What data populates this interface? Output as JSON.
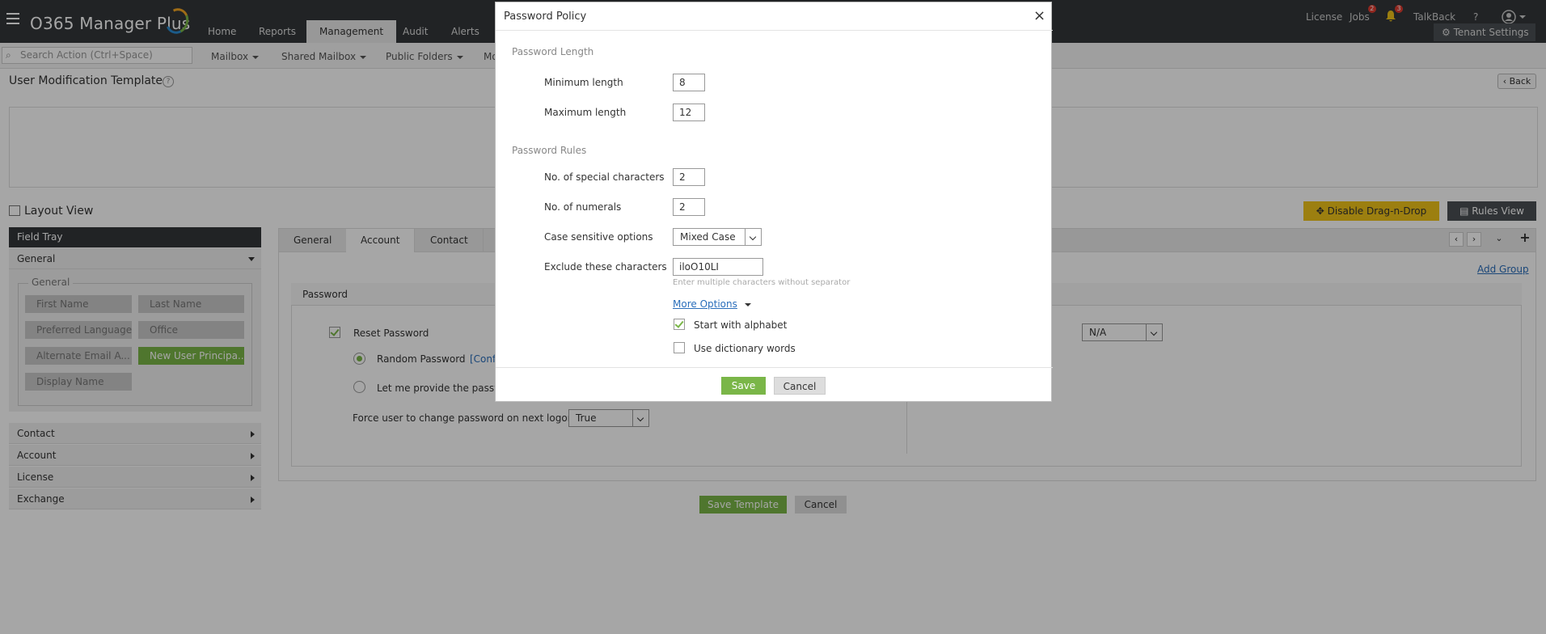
{
  "app": {
    "title": "O365 Manager Plus"
  },
  "nav": {
    "tabs": [
      "Home",
      "Reports",
      "Management",
      "Audit",
      "Alerts"
    ],
    "active": "Management"
  },
  "top_right": {
    "license": "License",
    "jobs": "Jobs",
    "jobs_badge": "2",
    "alerts_badge": "3",
    "talkback": "TalkBack",
    "help": "?",
    "tenant_settings": "Tenant Settings"
  },
  "subbar": {
    "search_placeholder": "Search Action (Ctrl+Space)",
    "items": [
      "Mailbox",
      "Shared Mailbox",
      "Public Folders",
      "Mo"
    ]
  },
  "page": {
    "title": "User Modification Template",
    "back": "Back"
  },
  "layout": {
    "label": "Layout View",
    "disable_drag": "Disable Drag-n-Drop",
    "rules_view": "Rules View"
  },
  "tray": {
    "header": "Field Tray",
    "general_section": "General",
    "legend": "General",
    "fields": [
      "First Name",
      "Last Name",
      "Preferred Language",
      "Office",
      "Alternate Email A...",
      "New User Principa...",
      "Display Name"
    ],
    "sections": [
      "Contact",
      "Account",
      "License",
      "Exchange"
    ]
  },
  "form": {
    "tabs": [
      "General",
      "Account",
      "Contact"
    ],
    "active_tab": "Account",
    "add_group": "Add Group",
    "group_title": "Password",
    "reset_password": "Reset Password",
    "random_password": "Random Password",
    "configure_link": "[Conf",
    "let_me_provide": "Let me provide the passwo",
    "force_change_label": "Force user to change password on next logon",
    "force_change_value": "True",
    "right_select_value": "N/A",
    "save_template": "Save Template",
    "cancel": "Cancel"
  },
  "modal": {
    "title": "Password Policy",
    "close": "×",
    "length_section": "Password Length",
    "min_label": "Minimum length",
    "min_value": "8",
    "max_label": "Maximum length",
    "max_value": "12",
    "rules_section": "Password Rules",
    "special_label": "No. of special characters",
    "special_value": "2",
    "numerals_label": "No. of numerals",
    "numerals_value": "2",
    "case_label": "Case sensitive options",
    "case_value": "Mixed Case",
    "exclude_label": "Exclude these characters",
    "exclude_value": "iloO10LI",
    "exclude_hint": "Enter multiple characters without separator",
    "more_options": "More Options",
    "start_alpha": "Start with alphabet",
    "start_alpha_checked": true,
    "dict_words": "Use dictionary words",
    "dict_words_checked": false,
    "save": "Save",
    "cancel": "Cancel"
  },
  "colors": {
    "topbar": "#33373a",
    "accent_green": "#7ab648",
    "accent_yellow": "#f0c419",
    "link_blue": "#2a6ebb"
  }
}
